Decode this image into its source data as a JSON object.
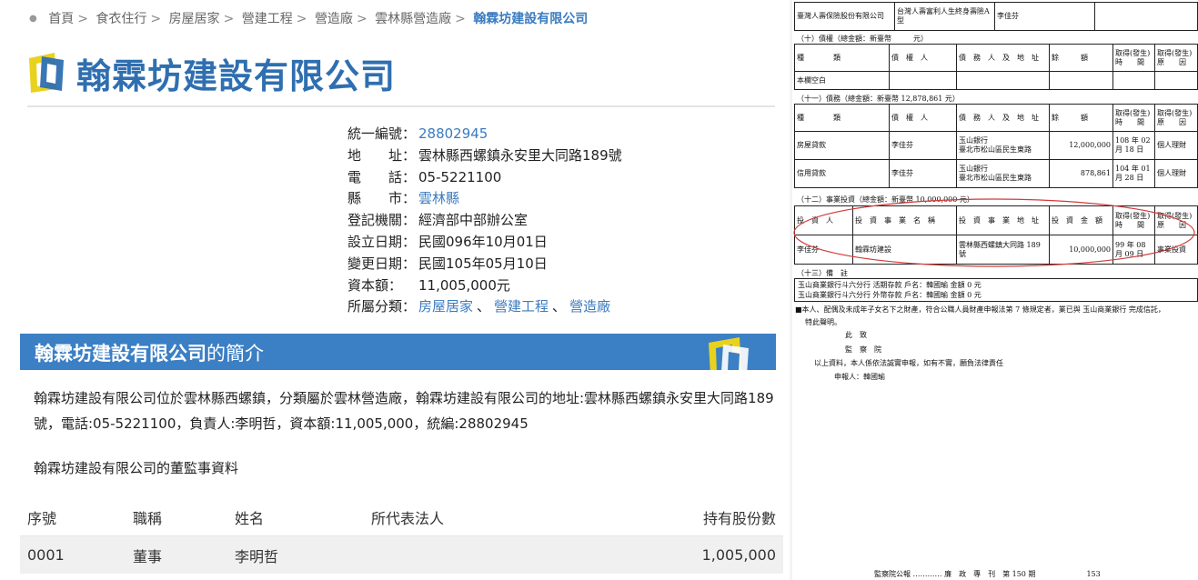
{
  "breadcrumb": {
    "items": [
      "首頁",
      "食衣住行",
      "房屋居家",
      "營建工程",
      "營造廠",
      "雲林縣營造廠"
    ],
    "current": "翰霖坊建設有限公司",
    "separator": ">"
  },
  "company": {
    "name": "翰霖坊建設有限公司",
    "fields": [
      {
        "label": "統一編號：",
        "value": "28802945",
        "link": true
      },
      {
        "label": "地　　址：",
        "value": "雲林縣西螺鎮永安里大同路189號",
        "link": false
      },
      {
        "label": "電　　話：",
        "value": "05-5221100",
        "link": false
      },
      {
        "label": "縣　　市：",
        "value": "雲林縣",
        "link": true
      },
      {
        "label": "登記機關：",
        "value": "經濟部中部辦公室",
        "link": false
      },
      {
        "label": "設立日期：",
        "value": "民國096年10月01日",
        "link": false
      },
      {
        "label": "變更日期：",
        "value": "民國105年05月10日",
        "link": false
      },
      {
        "label": "資本額：",
        "value": "11,005,000元",
        "link": false
      }
    ],
    "category_label": "所屬分類：",
    "categories": [
      "房屋居家",
      "營建工程",
      "營造廠"
    ],
    "category_sep": "、"
  },
  "intro": {
    "banner_name": "翰霖坊建設有限公司",
    "banner_suffix": "的簡介",
    "text": "翰霖坊建設有限公司位於雲林縣西螺鎮，分類屬於雲林營造廠，翰霖坊建設有限公司的地址:雲林縣西螺鎮永安里大同路189號，電話:05-5221100，負責人:李明哲，資本額:11,005,000，統編:28802945",
    "board_title": "翰霖坊建設有限公司的董監事資料"
  },
  "board_table": {
    "headers": [
      "序號",
      "職稱",
      "姓名",
      "所代表法人",
      "持有股份數"
    ],
    "rows": [
      [
        "0001",
        "董事",
        "李明哲",
        "",
        "1,005,000"
      ]
    ]
  },
  "document": {
    "top_row": [
      "臺灣人壽保險股份有限公司",
      "台灣人壽富利人生終身壽險A型",
      "李佳芬"
    ],
    "sec10": {
      "title": "（十）債權（總金額：新臺幣　　　元）",
      "headers": [
        "種　　　　類",
        "債　權　人",
        "債　務　人　及　地　址",
        "餘　　　額",
        "取得(發生)時　　間",
        "取得(發生)原　　因"
      ],
      "rows": [
        [
          "本欄空白",
          "",
          "",
          "",
          "",
          ""
        ]
      ]
    },
    "sec11": {
      "title": "（十一）債務（總金額：新臺幣 12,878,861 元）",
      "headers": [
        "種　　　　類",
        "債　權　人",
        "債　務　人　及　地　址",
        "餘　　　額",
        "取得(發生)時　　間",
        "取得(發生)原　　因"
      ],
      "rows": [
        [
          "房屋貸款",
          "李佳芬",
          "玉山銀行\n臺北市松山區民生東路",
          "12,000,000",
          "108 年 02 月 18 日",
          "個人理財"
        ],
        [
          "信用貸款",
          "李佳芬",
          "玉山銀行\n臺北市松山區民生東路",
          "878,861",
          "104 年 01 月 28 日",
          "個人理財"
        ]
      ]
    },
    "sec12": {
      "title": "（十二）事業投資（總金額：新臺幣 10,000,000 元）",
      "headers": [
        "投　資　人",
        "投　資　事　業　名　稱",
        "投　資　事　業　地　址",
        "投　資　金　額",
        "取得(發生)時　　間",
        "取得(發生)原　　因"
      ],
      "rows": [
        [
          "李佳芬",
          "翰霖坊建設",
          "雲林縣西螺鎮大同路 189 號",
          "10,000,000",
          "99 年 08 月 09 日",
          "事業投資"
        ]
      ]
    },
    "sec13": {
      "title": "（十三）備　註",
      "lines": [
        "玉山商業銀行斗六分行 活期存款 戶名：韓國瑜 金額 0 元",
        "玉山商業銀行斗六分行 外幣存款 戶名：韓國瑜 金額 0 元"
      ]
    },
    "declaration": "■本人、配偶及未成年子女名下之財產，符合公職人員財產申報法第 7 條規定者，業已與 玉山商業銀行 完成信託，",
    "declaration2": "特此聲明。",
    "to1": "此　致",
    "to2": "監　察　院",
    "statement": "以上資料，本人係依法誠實申報，如有不實，願負法律責任",
    "applicant": "申報人：韓國瑜",
    "footer": "監察院公報 ………… 廉　政　專　刊　第 150 期　　　　　　　153"
  },
  "colors": {
    "accent": "#3b7fc4",
    "link": "#3a7bbf",
    "logo_yellow": "#e8d21e",
    "logo_blue": "#2f6fb0",
    "annotation": "#d23a3a"
  }
}
